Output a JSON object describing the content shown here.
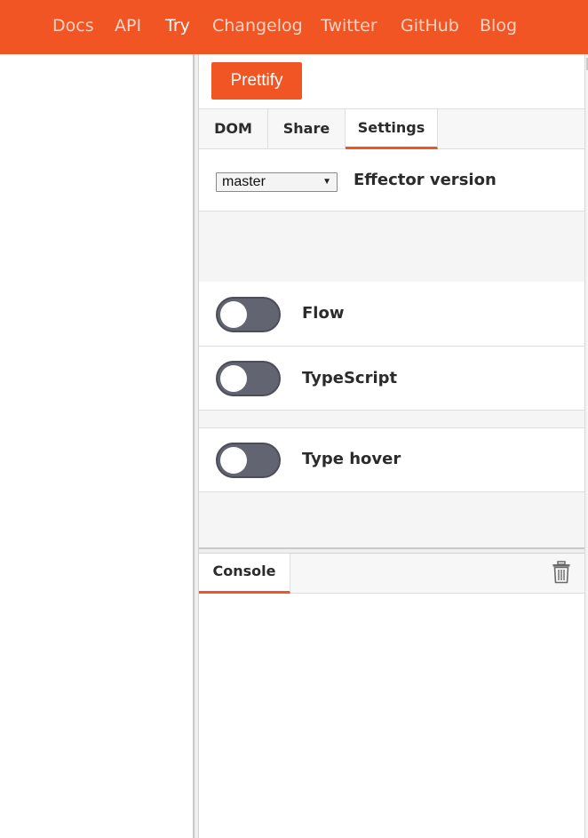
{
  "nav": {
    "items": [
      {
        "label": "Docs"
      },
      {
        "label": "API"
      },
      {
        "label": "Try"
      },
      {
        "label": "Changelog"
      },
      {
        "label": "Twitter"
      },
      {
        "label": "GitHub"
      },
      {
        "label": "Blog"
      }
    ],
    "active": "Try"
  },
  "toolbar": {
    "prettify_label": "Prettify"
  },
  "tabs": [
    {
      "label": "DOM"
    },
    {
      "label": "Share"
    },
    {
      "label": "Settings"
    }
  ],
  "active_tab": "Settings",
  "settings": {
    "version_select": {
      "value": "master",
      "label": "Effector version"
    },
    "flow": {
      "label": "Flow",
      "enabled": false
    },
    "typescript": {
      "label": "TypeScript",
      "enabled": false
    },
    "type_hover": {
      "label": "Type hover",
      "enabled": false
    }
  },
  "console": {
    "tab_label": "Console",
    "clear_icon": "trash-icon"
  },
  "colors": {
    "accent": "#f05523",
    "toggle_off": "#626471",
    "panel_bg": "#f5f5f5"
  }
}
